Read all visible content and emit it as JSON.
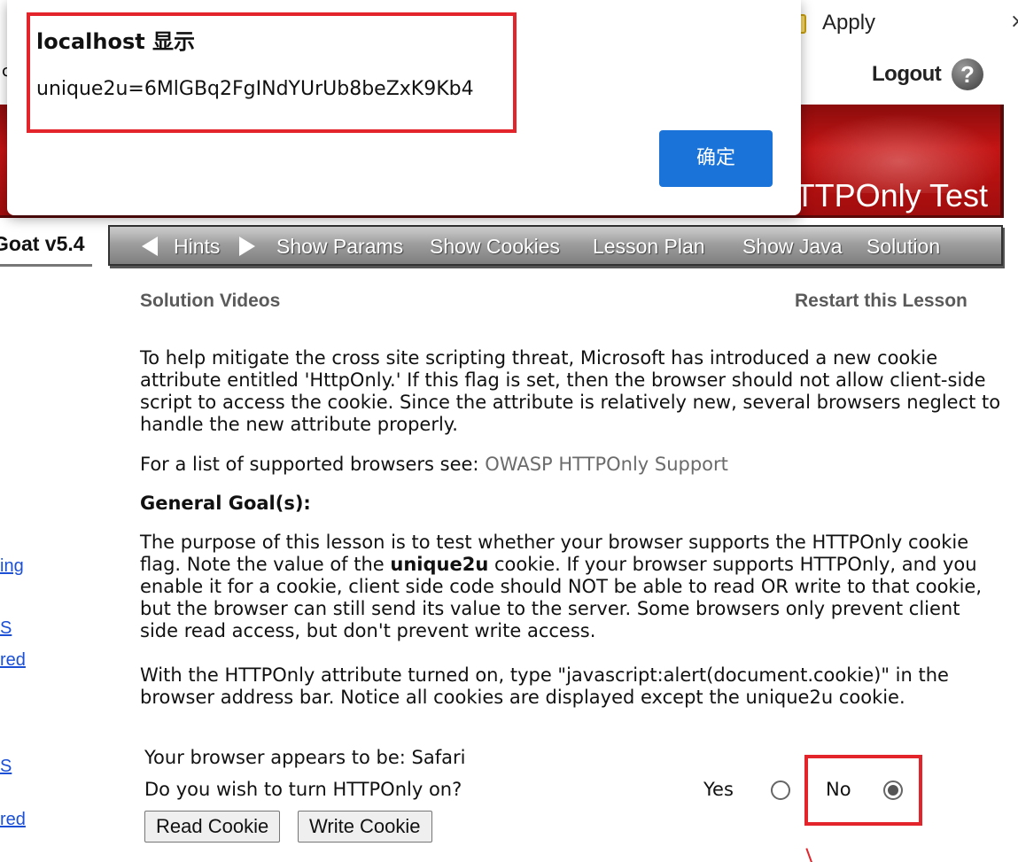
{
  "browser": {
    "apply_label": "Apply",
    "close_glyph": "×",
    "left_fragment": "c"
  },
  "header": {
    "logout_label": "Logout",
    "help_glyph": "?",
    "banner_title": "TTPOnly Test",
    "brand": "Goat  v5.4"
  },
  "nav": {
    "hints": "Hints",
    "show_params": "Show Params",
    "show_cookies": "Show Cookies",
    "lesson_plan": "Lesson Plan",
    "show_java": "Show Java",
    "solution": "Solution"
  },
  "sidebar": {
    "links": [
      "ing",
      "S",
      "red",
      "S",
      "red"
    ]
  },
  "lesson": {
    "solution_videos": "Solution Videos",
    "restart": "Restart this Lesson",
    "para1": "To help mitigate the cross site scripting threat, Microsoft has introduced a new cookie attribute entitled 'HttpOnly.' If this flag is set, then the browser should not allow client-side script to access the cookie. Since the attribute is relatively new, several browsers neglect to handle the new attribute properly.",
    "para2_prefix": "For a list of supported browsers see: ",
    "para2_link": "OWASP HTTPOnly Support",
    "goal_heading": "General Goal(s):",
    "para3_a": "The purpose of this lesson is to test whether your browser supports the HTTPOnly cookie flag. Note the value of the ",
    "para3_bold": "unique2u",
    "para3_b": " cookie. If your browser supports HTTPOnly, and you enable it for a cookie, client side code should NOT be able to read OR write to that cookie, but the browser can still send its value to the server. Some browsers only prevent client side read access, but don't prevent write access.",
    "para4": "With the HTTPOnly attribute turned on, type \"javascript:alert(document.cookie)\" in the browser address bar. Notice all cookies are displayed except the unique2u cookie."
  },
  "form": {
    "browser_line": "Your browser appears to be: Safari",
    "question": "Do you wish to turn HTTPOnly on?",
    "yes_label": "Yes",
    "no_label": "No",
    "selected": "No",
    "read_button": "Read Cookie",
    "write_button": "Write Cookie"
  },
  "dialog": {
    "title": "localhost 显示",
    "message": "unique2u=6MlGBq2FgINdYUrUb8beZxK9Kb4",
    "ok_label": "确定",
    "ok_color": "#1a73d9"
  },
  "annotation_color": "#e3242b"
}
